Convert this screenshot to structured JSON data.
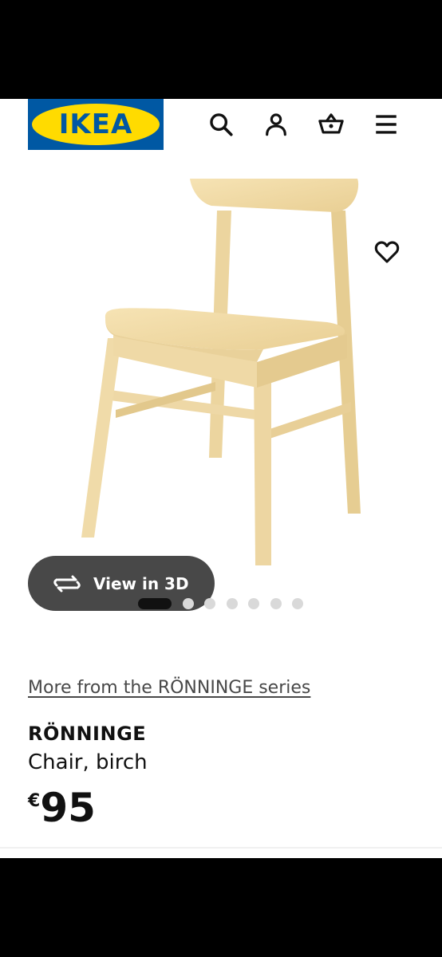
{
  "header": {
    "logo_text": "IKEA",
    "logo_colors": {
      "blue": "#0058a3",
      "yellow": "#ffdb00"
    },
    "icons": [
      "search-icon",
      "account-icon",
      "basket-icon",
      "menu-icon"
    ]
  },
  "gallery": {
    "view_in_3d_label": "View in 3D",
    "favourite_icon": "heart-outline-icon",
    "image_count": 7,
    "active_image": 1
  },
  "product": {
    "series_link": "More from the RÖNNINGE series",
    "name": "RÖNNINGE",
    "description": "Chair, birch",
    "currency": "€",
    "price": "95"
  }
}
